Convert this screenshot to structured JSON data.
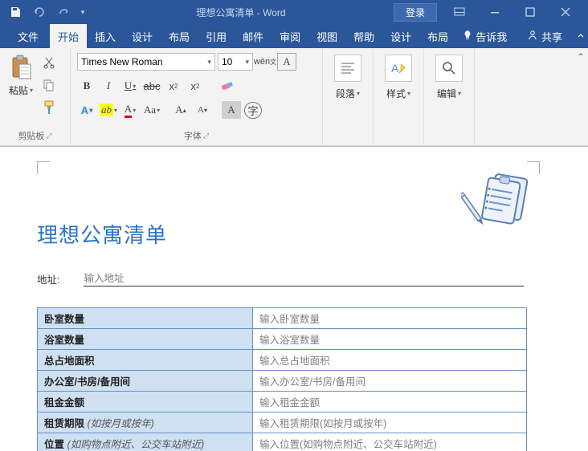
{
  "titlebar": {
    "title": "理想公寓清单 - Word",
    "login": "登录"
  },
  "tabs": {
    "file": "文件",
    "home": "开始",
    "insert": "插入",
    "design": "设计",
    "layout": "布局",
    "references": "引用",
    "mailings": "邮件",
    "review": "审阅",
    "view": "视图",
    "help": "帮助",
    "design2": "设计",
    "layout2": "布局",
    "tellme": "告诉我",
    "share": "共享"
  },
  "ribbon": {
    "clipboard": {
      "label": "剪贴板",
      "paste": "粘贴"
    },
    "font": {
      "label": "字体",
      "name": "Times New Roman",
      "size": "10"
    },
    "paragraph": {
      "label": "段落"
    },
    "styles": {
      "label": "样式"
    },
    "editing": {
      "label": "编辑"
    }
  },
  "doc": {
    "title": "理想公寓清单",
    "address_label": "地址:",
    "address_value": "输入地址",
    "rows": [
      {
        "label": "卧室数量",
        "hint": "",
        "value": "输入卧室数量"
      },
      {
        "label": "浴室数量",
        "hint": "",
        "value": "输入浴室数量"
      },
      {
        "label": "总占地面积",
        "hint": "",
        "value": "输入总占地面积"
      },
      {
        "label": "办公室/书房/备用间",
        "hint": "",
        "value": "输入办公室/书房/备用间"
      },
      {
        "label": "租金金额",
        "hint": "",
        "value": "输入租金金额"
      },
      {
        "label": "租赁期限",
        "hint": "(如按月或按年)",
        "value": "输入租赁期限(如按月或按年)"
      },
      {
        "label": "位置",
        "hint": "(如购物点附近、公交车站附近)",
        "value": "输入位置(如购物点附近、公交车站附近)"
      }
    ]
  }
}
